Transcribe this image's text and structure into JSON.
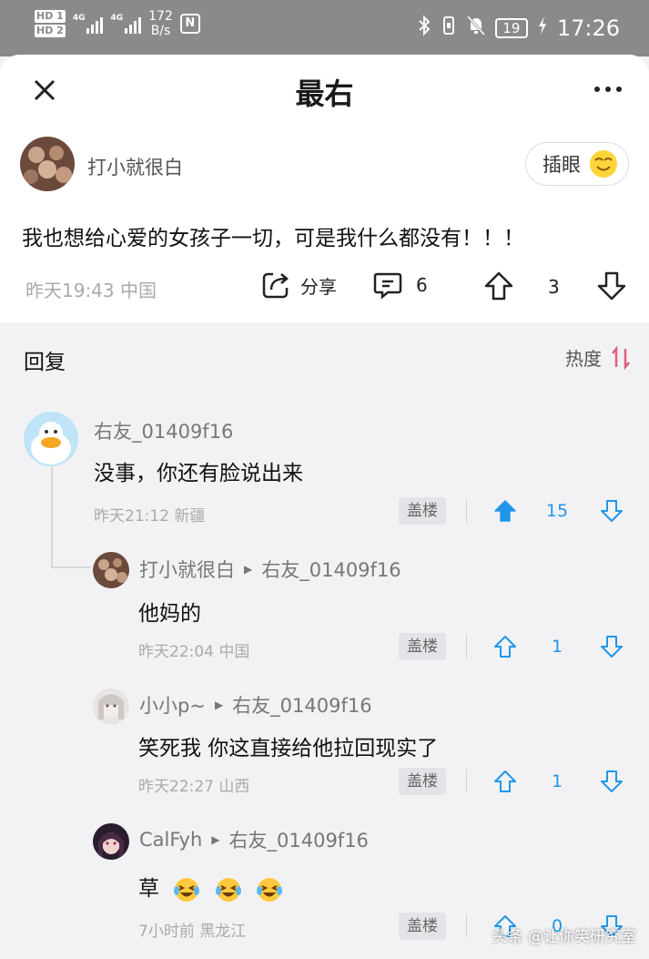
{
  "status_bar": {
    "hd1": "HD 1",
    "hd2": "HD 2",
    "sig1_tag": "4G",
    "sig2_tag": "4G",
    "speed_value": "172",
    "speed_unit": "B/s",
    "nfc": "N",
    "battery": "19",
    "time": "17:26"
  },
  "sheet": {
    "title": "最右"
  },
  "post": {
    "author": "打小就很白",
    "chahyan_label": "插眼",
    "text": "我也想给心爱的女孩子一切，可是我什么都没有！！！",
    "time_location": "昨天19:43 中国",
    "share_label": "分享",
    "comment_count": "6",
    "like_count": "3"
  },
  "replies": {
    "title": "回复",
    "sort_label": "热度",
    "floor_label": "盖楼",
    "items": [
      {
        "name": "右友_01409f16",
        "reply_to": "",
        "text": "没事，你还有脸说出来",
        "meta": "昨天21:12 新疆",
        "votes": "15"
      },
      {
        "name": "打小就很白",
        "reply_to": "右友_01409f16",
        "text": "他妈的",
        "meta": "昨天22:04 中国",
        "votes": "1"
      },
      {
        "name": "小小p~",
        "reply_to": "右友_01409f16",
        "text": "笑死我 你这直接给他拉回现实了",
        "meta": "昨天22:27 山西",
        "votes": "1"
      },
      {
        "name": "CalFyh",
        "reply_to": "右友_01409f16",
        "text": "草",
        "meta": "7小时前 黑龙江",
        "votes": "0"
      }
    ]
  },
  "watermark": "头条 @让你笑研究室",
  "colors": {
    "accent_blue": "#2196e8",
    "sort_red": "#e0607a",
    "statusbar": "#8a8a8a"
  }
}
